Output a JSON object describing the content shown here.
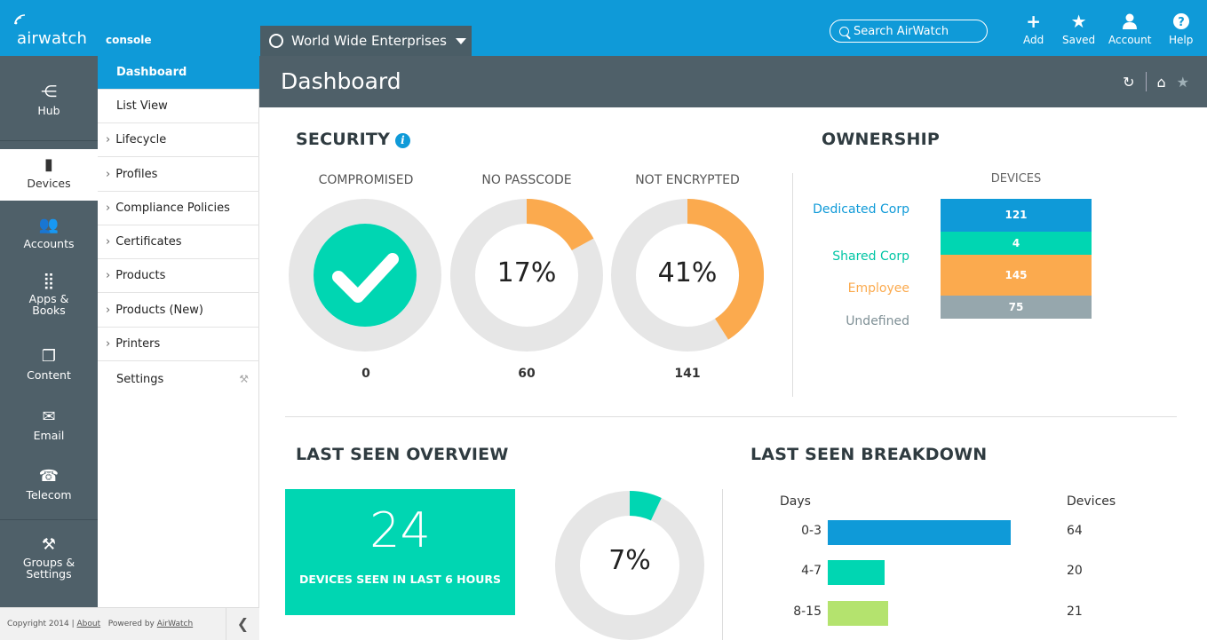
{
  "app": {
    "brand": "airwatch",
    "console": "console",
    "org": "World Wide Enterprises",
    "search_placeholder": "Search AirWatch",
    "actions": [
      {
        "label": "Add",
        "icon": "plus-icon"
      },
      {
        "label": "Saved",
        "icon": "star-icon"
      },
      {
        "label": "Account",
        "icon": "user-icon"
      },
      {
        "label": "Help",
        "icon": "help-icon"
      }
    ]
  },
  "rail": [
    {
      "label": "Hub",
      "icon": "hub-icon"
    },
    {
      "label": "Devices",
      "icon": "device-icon"
    },
    {
      "label": "Accounts",
      "icon": "accounts-icon"
    },
    {
      "label": "Apps & Books",
      "icon": "apps-icon"
    },
    {
      "label": "Content",
      "icon": "content-icon"
    },
    {
      "label": "Email",
      "icon": "email-icon"
    },
    {
      "label": "Telecom",
      "icon": "phone-icon"
    },
    {
      "label": "Groups & Settings",
      "icon": "tools-icon"
    }
  ],
  "submenu": [
    {
      "label": "Dashboard"
    },
    {
      "label": "List View"
    },
    {
      "label": "Lifecycle"
    },
    {
      "label": "Profiles"
    },
    {
      "label": "Compliance Policies"
    },
    {
      "label": "Certificates"
    },
    {
      "label": "Products"
    },
    {
      "label": "Products (New)"
    },
    {
      "label": "Printers"
    },
    {
      "label": "Settings"
    }
  ],
  "footer": {
    "copyright": "Copyright 2014 |",
    "about": "About",
    "powered": "Powered by",
    "powered_link": "AirWatch"
  },
  "page": {
    "title": "Dashboard"
  },
  "security": {
    "title": "SECURITY",
    "gauges": [
      {
        "label": "COMPROMISED",
        "count": "0",
        "pct": null,
        "fraction": 0
      },
      {
        "label": "NO PASSCODE",
        "count": "60",
        "pct": "17%",
        "fraction": 0.17
      },
      {
        "label": "NOT ENCRYPTED",
        "count": "141",
        "pct": "41%",
        "fraction": 0.41
      }
    ]
  },
  "ownership": {
    "title": "OWNERSHIP",
    "column": "DEVICES",
    "rows": [
      {
        "label": "Dedicated Corp",
        "value": "121",
        "color": "#0f9ad8"
      },
      {
        "label": "Shared Corp",
        "value": "4",
        "color": "#00d6b2"
      },
      {
        "label": "Employee",
        "value": "145",
        "color": "#fbaa4e"
      },
      {
        "label": "Undefined",
        "value": "75",
        "color": "#96a7ad"
      }
    ]
  },
  "last_seen": {
    "title": "LAST SEEN OVERVIEW",
    "count": "24",
    "caption": "DEVICES SEEN IN LAST 6 HOURS",
    "pct": "7%",
    "fraction": 0.07
  },
  "breakdown": {
    "title": "LAST SEEN BREAKDOWN",
    "col_days": "Days",
    "col_devices": "Devices",
    "rows": [
      {
        "days": "0-3",
        "devices": 64,
        "color": "#0f9ad8"
      },
      {
        "days": "4-7",
        "devices": 20,
        "color": "#00d6b2"
      },
      {
        "days": "8-15",
        "devices": 21,
        "color": "#b4e36e"
      }
    ]
  },
  "colors": {
    "accent": "#0f9ad8",
    "teal": "#00d6b2",
    "orange": "#fbaa4e",
    "ring": "#e6e6e6",
    "nav": "#4f6069"
  }
}
